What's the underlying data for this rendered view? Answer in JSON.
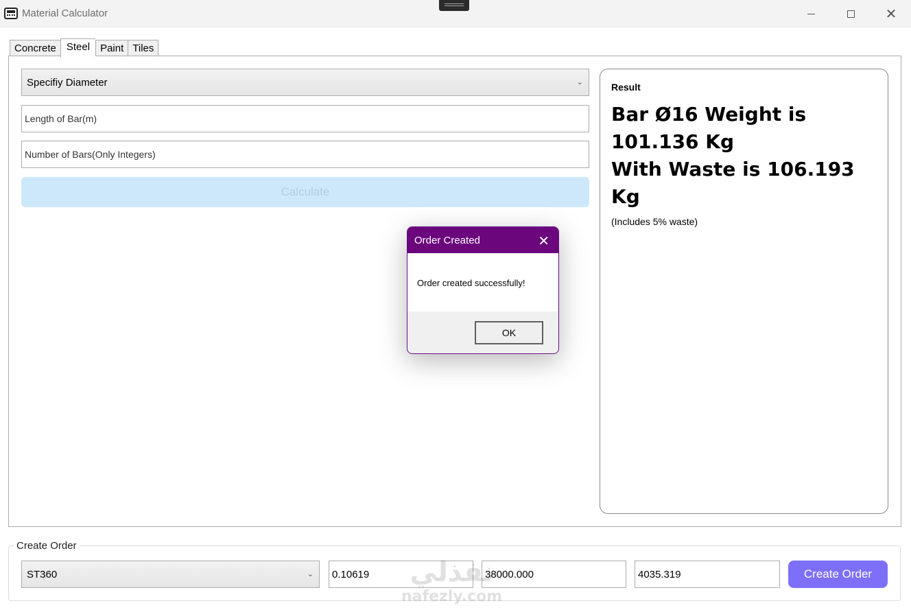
{
  "window": {
    "title": "Material Calculator",
    "controls": {
      "minimize": "minimize",
      "maximize": "maximize",
      "close": "✕"
    }
  },
  "tabs": [
    {
      "label": "Concrete",
      "active": false
    },
    {
      "label": "Steel",
      "active": true
    },
    {
      "label": "Paint",
      "active": false
    },
    {
      "label": "Tiles",
      "active": false
    }
  ],
  "steel_form": {
    "diameter_dropdown": "Specifiy Diameter",
    "length_placeholder": "Length of Bar(m)",
    "count_placeholder": "Number of Bars(Only Integers)",
    "calculate_label": "Calculate"
  },
  "result": {
    "label": "Result",
    "line1": "Bar Ø16 Weight is 101.136 Kg",
    "line2": "With Waste is 106.193 Kg",
    "note": "(Includes 5% waste)"
  },
  "create_order": {
    "legend": "Create Order",
    "material_selected": "ST360",
    "field1": "0.10619",
    "field2": "38000.000",
    "field3": "4035.319",
    "button_label": "Create Order"
  },
  "dialog": {
    "title": "Order Created",
    "message": "Order created successfully!",
    "ok_label": "OK",
    "close_glyph": "✕"
  },
  "watermark": {
    "arabic": "نفذلي",
    "latin": "nafezly.com"
  },
  "colors": {
    "dialog_title": "#6b067d",
    "create_button": "#7d6ff8",
    "calculate_button_disabled": "#cde8fb"
  }
}
